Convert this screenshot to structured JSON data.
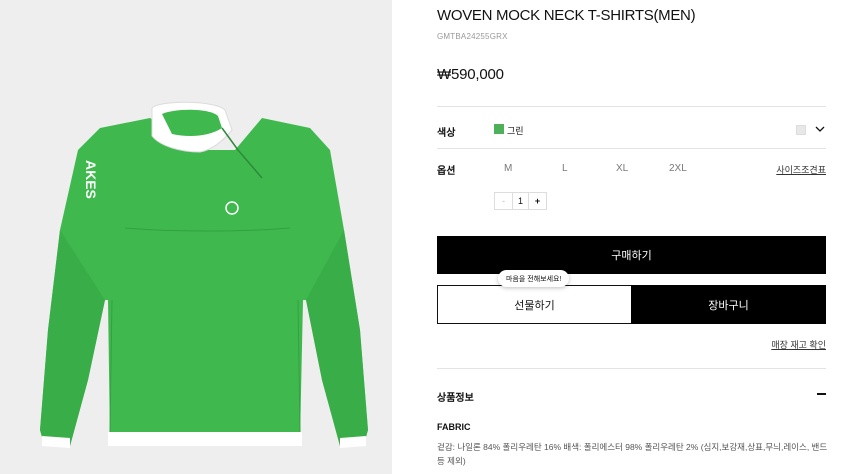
{
  "product": {
    "title": "WOVEN MOCK NECK T-SHIRTS(MEN)",
    "code": "GMTBA24255GRX",
    "price": "₩590,000",
    "image_alt": "green woven mock neck long sleeve shirt",
    "print_text": "AKES",
    "colors": {
      "garment": "#3fb94e",
      "trim": "#ffffff",
      "background": "#eeeeee"
    }
  },
  "color_option": {
    "label": "색상",
    "value": "그린",
    "swatch_color": "#4fb05a"
  },
  "size_option": {
    "label": "옵션",
    "sizes": [
      "M",
      "L",
      "XL",
      "2XL"
    ],
    "size_guide": "사이즈조견표"
  },
  "quantity": {
    "minus": "-",
    "value": "1",
    "plus": "+"
  },
  "actions": {
    "buy": "구매하기",
    "gift_tooltip": "마음을 전해보세요!",
    "gift": "선물하기",
    "cart": "장바구니",
    "stock_check": "매장 재고 확인"
  },
  "details": {
    "title": "상품정보",
    "fabric_title": "FABRIC",
    "fabric_desc": "겉감: 나일론 84% 폴리우레탄 16% 배색: 폴리에스터 98% 폴리우레탄 2% (심지,보강재,상표,무늬,레이스, 밴드 등 제외)"
  }
}
